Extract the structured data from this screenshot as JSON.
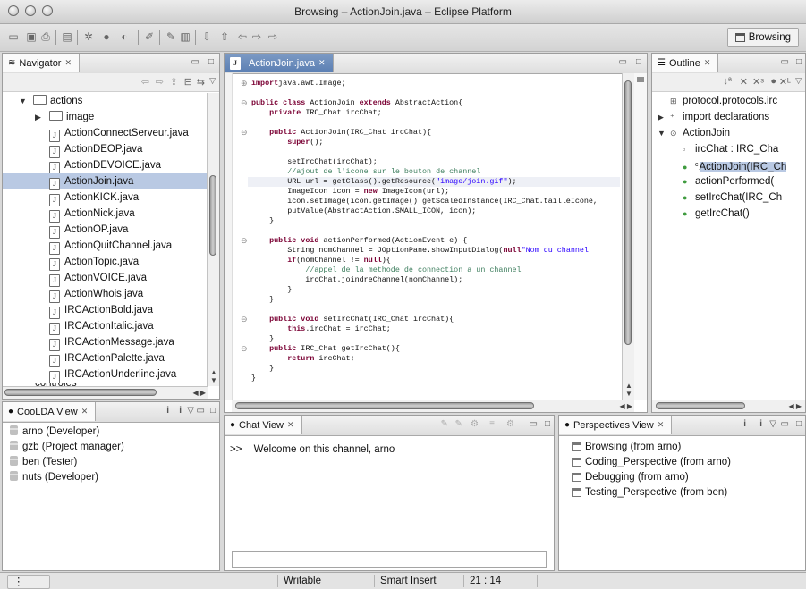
{
  "window": {
    "title": "Browsing – ActionJoin.java – Eclipse Platform"
  },
  "toolbar": {
    "perspective_label": "Browsing"
  },
  "navigator": {
    "tab_label": "Navigator",
    "items": [
      {
        "label": "actions",
        "level": 0,
        "expanded": true,
        "kind": "folder"
      },
      {
        "label": "image",
        "level": 1,
        "expanded": false,
        "kind": "folder"
      },
      {
        "label": "ActionConnectServeur.java",
        "level": 2,
        "kind": "java"
      },
      {
        "label": "ActionDEOP.java",
        "level": 2,
        "kind": "java"
      },
      {
        "label": "ActionDEVOICE.java",
        "level": 2,
        "kind": "java"
      },
      {
        "label": "ActionJoin.java",
        "level": 2,
        "kind": "java",
        "selected": true
      },
      {
        "label": "ActionKICK.java",
        "level": 2,
        "kind": "java"
      },
      {
        "label": "ActionNick.java",
        "level": 2,
        "kind": "java"
      },
      {
        "label": "ActionOP.java",
        "level": 2,
        "kind": "java"
      },
      {
        "label": "ActionQuitChannel.java",
        "level": 2,
        "kind": "java"
      },
      {
        "label": "ActionTopic.java",
        "level": 2,
        "kind": "java"
      },
      {
        "label": "ActionVOICE.java",
        "level": 2,
        "kind": "java"
      },
      {
        "label": "ActionWhois.java",
        "level": 2,
        "kind": "java"
      },
      {
        "label": "IRCActionBold.java",
        "level": 2,
        "kind": "java"
      },
      {
        "label": "IRCActionItalic.java",
        "level": 2,
        "kind": "java"
      },
      {
        "label": "IRCActionMessage.java",
        "level": 2,
        "kind": "java"
      },
      {
        "label": "IRCActionPalette.java",
        "level": 2,
        "kind": "java"
      },
      {
        "label": "IRCActionUnderline.java",
        "level": 2,
        "kind": "java"
      }
    ],
    "partial_item": "controles"
  },
  "editor": {
    "tab_label": "ActionJoin.java",
    "lines": [
      {
        "fold": "+",
        "segs": [
          [
            "kw",
            "import"
          ],
          [
            "",
            "java.awt.Image;"
          ]
        ]
      },
      {
        "fold": "",
        "segs": [
          [
            "",
            ""
          ]
        ]
      },
      {
        "fold": "-",
        "segs": [
          [
            "kw",
            "public class"
          ],
          [
            "",
            " ActionJoin "
          ],
          [
            "kw",
            "extends"
          ],
          [
            "",
            " AbstractAction{"
          ]
        ]
      },
      {
        "fold": "",
        "segs": [
          [
            "",
            "    "
          ],
          [
            "kw",
            "private"
          ],
          [
            "",
            " IRC_Chat ircChat;"
          ]
        ]
      },
      {
        "fold": "",
        "segs": [
          [
            "",
            ""
          ]
        ]
      },
      {
        "fold": "-",
        "segs": [
          [
            "",
            "    "
          ],
          [
            "kw",
            "public"
          ],
          [
            "",
            " ActionJoin(IRC_Chat ircChat){"
          ]
        ]
      },
      {
        "fold": "",
        "segs": [
          [
            "",
            "        "
          ],
          [
            "kw",
            "super"
          ],
          [
            "",
            "();"
          ]
        ]
      },
      {
        "fold": "",
        "segs": [
          [
            "",
            ""
          ]
        ]
      },
      {
        "fold": "",
        "segs": [
          [
            "",
            "        setIrcChat(ircChat);"
          ]
        ]
      },
      {
        "fold": "",
        "segs": [
          [
            "",
            "        "
          ],
          [
            "cm",
            "//ajout de l'icone sur le bouton de channel"
          ]
        ]
      },
      {
        "fold": "",
        "hl": true,
        "segs": [
          [
            "",
            "        URL url = getClass().getResource("
          ],
          [
            "st",
            "\"image/join.gif\""
          ],
          [
            "",
            ");"
          ]
        ]
      },
      {
        "fold": "",
        "segs": [
          [
            "",
            "        ImageIcon icon = "
          ],
          [
            "kw",
            "new"
          ],
          [
            "",
            " ImageIcon(url);"
          ]
        ]
      },
      {
        "fold": "",
        "segs": [
          [
            "",
            "        icon.setImage(icon.getImage().getScaledInstance(IRC_Chat.tailleIcone,"
          ]
        ]
      },
      {
        "fold": "",
        "segs": [
          [
            "",
            "        putValue(AbstractAction.SMALL_ICON, icon);"
          ]
        ]
      },
      {
        "fold": "",
        "segs": [
          [
            "",
            "    }"
          ]
        ]
      },
      {
        "fold": "",
        "segs": [
          [
            "",
            ""
          ]
        ]
      },
      {
        "fold": "-",
        "segs": [
          [
            "",
            "    "
          ],
          [
            "kw",
            "public void"
          ],
          [
            "",
            " actionPerformed(ActionEvent e) {"
          ]
        ]
      },
      {
        "fold": "",
        "segs": [
          [
            "",
            "        String nomChannel = JOptionPane.showInputDialog("
          ],
          [
            "kw",
            "null"
          ],
          [
            ", "
          ],
          [
            "st",
            "\"Nom du channel"
          ]
        ]
      },
      {
        "fold": "",
        "segs": [
          [
            "",
            "        "
          ],
          [
            "kw",
            "if"
          ],
          [
            "",
            "(nomChannel != "
          ],
          [
            "kw",
            "null"
          ],
          [
            "",
            "){"
          ]
        ]
      },
      {
        "fold": "",
        "segs": [
          [
            "",
            "            "
          ],
          [
            "cm",
            "//appel de la methode de connection a un channel"
          ]
        ]
      },
      {
        "fold": "",
        "segs": [
          [
            "",
            "            ircChat.joindreChannel(nomChannel);"
          ]
        ]
      },
      {
        "fold": "",
        "segs": [
          [
            "",
            "        }"
          ]
        ]
      },
      {
        "fold": "",
        "segs": [
          [
            "",
            "    }"
          ]
        ]
      },
      {
        "fold": "",
        "segs": [
          [
            "",
            ""
          ]
        ]
      },
      {
        "fold": "-",
        "segs": [
          [
            "",
            "    "
          ],
          [
            "kw",
            "public void"
          ],
          [
            "",
            " setIrcChat(IRC_Chat ircChat){"
          ]
        ]
      },
      {
        "fold": "",
        "segs": [
          [
            "",
            "        "
          ],
          [
            "kw",
            "this"
          ],
          [
            "",
            ".ircChat = ircChat;"
          ]
        ]
      },
      {
        "fold": "",
        "segs": [
          [
            "",
            "    }"
          ]
        ]
      },
      {
        "fold": "-",
        "segs": [
          [
            "",
            "    "
          ],
          [
            "kw",
            "public"
          ],
          [
            "",
            " IRC_Chat getIrcChat(){"
          ]
        ]
      },
      {
        "fold": "",
        "segs": [
          [
            "",
            "        "
          ],
          [
            "kw",
            "return"
          ],
          [
            "",
            " ircChat;"
          ]
        ]
      },
      {
        "fold": "",
        "segs": [
          [
            "",
            "    }"
          ]
        ]
      },
      {
        "fold": "",
        "segs": [
          [
            "",
            "}"
          ]
        ]
      }
    ]
  },
  "outline": {
    "tab_label": "Outline",
    "items": [
      {
        "label": "protocol.protocols.irc",
        "level": 0,
        "icon": "package-icon"
      },
      {
        "label": "import declarations",
        "level": 0,
        "icon": "imports-icon",
        "twist": "▶"
      },
      {
        "label": "ActionJoin",
        "level": 0,
        "icon": "class-icon",
        "twist": "▼"
      },
      {
        "label": "ircChat : IRC_Cha",
        "level": 1,
        "icon": "field-icon"
      },
      {
        "label": "ActionJoin(IRC_Ch",
        "level": 1,
        "icon": "constructor-icon",
        "selected": true,
        "prefix": "c"
      },
      {
        "label": "actionPerformed(",
        "level": 1,
        "icon": "method-icon"
      },
      {
        "label": "setIrcChat(IRC_Ch",
        "level": 1,
        "icon": "method-icon"
      },
      {
        "label": "getIrcChat()",
        "level": 1,
        "icon": "method-icon"
      }
    ]
  },
  "coolda": {
    "tab_label": "CooLDA View",
    "users": [
      "arno (Developer)",
      "gzb (Project manager)",
      "ben (Tester)",
      "nuts (Developer)"
    ]
  },
  "chat": {
    "tab_label": "Chat View",
    "prompt": ">>",
    "message": "Welcome on this channel, arno",
    "input_value": ""
  },
  "perspectives": {
    "tab_label": "Perspectives View",
    "items": [
      "Browsing (from arno)",
      "Coding_Perspective (from arno)",
      "Debugging (from arno)",
      "Testing_Perspective (from ben)"
    ]
  },
  "status": {
    "writable": "Writable",
    "insert_mode": "Smart Insert",
    "position": "21 : 14"
  }
}
